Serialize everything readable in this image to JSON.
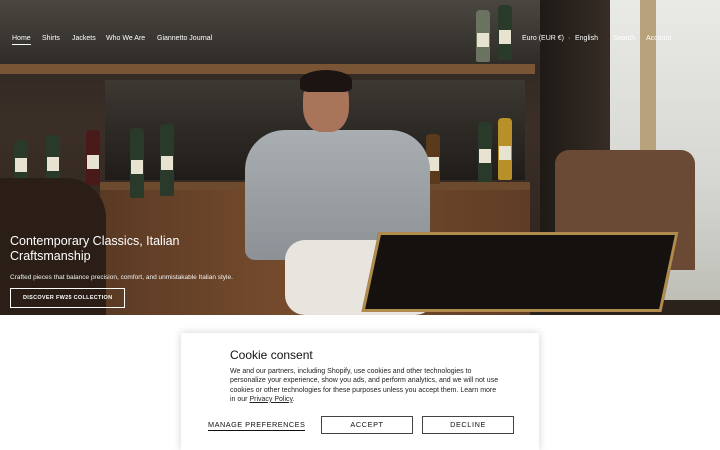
{
  "nav": {
    "items": [
      "Home",
      "Shirts",
      "Jackets",
      "Who We Are",
      "Giannetto Journal"
    ],
    "currency": "Euro (EUR €)",
    "language": "English",
    "search": "Search",
    "account": "Account"
  },
  "hero": {
    "title": "Contemporary Classics, Italian Craftsmanship",
    "subtitle": "Crafted pieces that balance precision, comfort, and unmistakable Italian style.",
    "cta": "DISCOVER FW25 COLLECTION"
  },
  "cookie": {
    "title": "Cookie consent",
    "body": "We and our partners, including Shopify, use cookies and other technologies to personalize your experience, show you ads, and perform analytics, and we will not use cookies or other technologies for these purposes unless you accept them. Learn more in our",
    "policy_link": "Privacy Policy",
    "manage": "MANAGE PREFERENCES",
    "accept": "ACCEPT",
    "decline": "DECLINE"
  }
}
